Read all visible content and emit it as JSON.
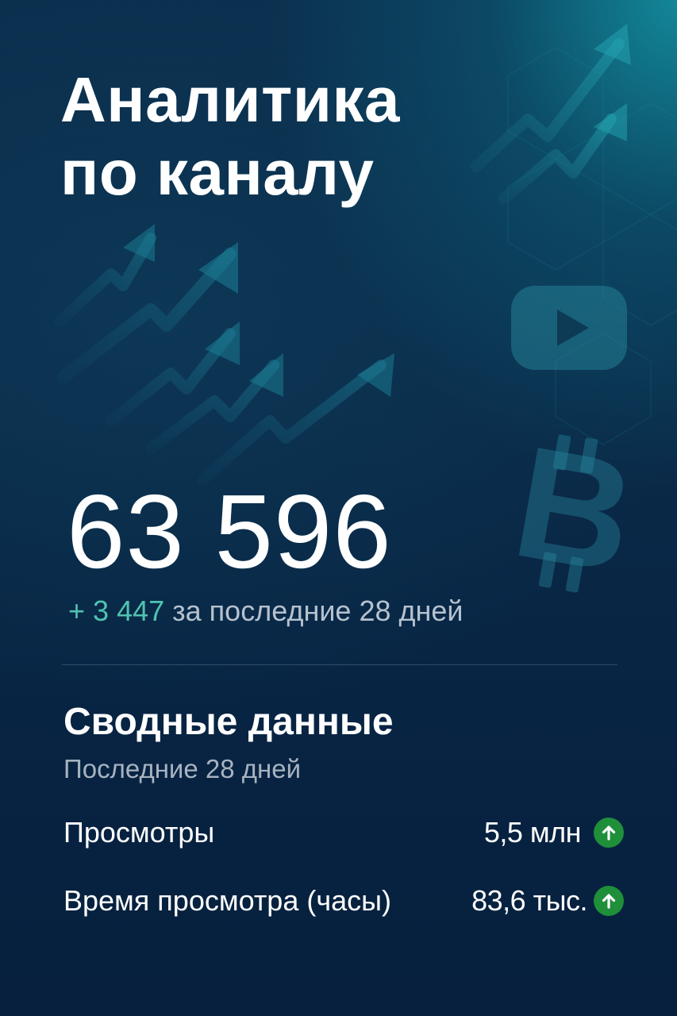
{
  "header": {
    "title_line1": "Аналитика",
    "title_line2": "по каналу"
  },
  "subscribers": {
    "total": "63 596",
    "delta_sign": "+",
    "delta_value": "3 447",
    "delta_period": "за последние 28 дней"
  },
  "summary": {
    "title": "Сводные данные",
    "subtitle": "Последние 28 дней",
    "stats": [
      {
        "label": "Просмотры",
        "value": "5,5 млн",
        "trend_icon": "arrow-up-icon"
      },
      {
        "label": "Время просмотра (часы)",
        "value": "83,6 тыс.",
        "trend_icon": "arrow-up-icon"
      }
    ]
  },
  "decor_icons": [
    "trend-up-arrows",
    "youtube-play-icon",
    "bitcoin-icon"
  ],
  "colors": {
    "background_dark": "#082443",
    "background_teal": "#1496a5",
    "accent_teal": "#4fc3b1",
    "muted_text": "#a7b3c0",
    "trend_up_green": "#1f8f3a"
  }
}
